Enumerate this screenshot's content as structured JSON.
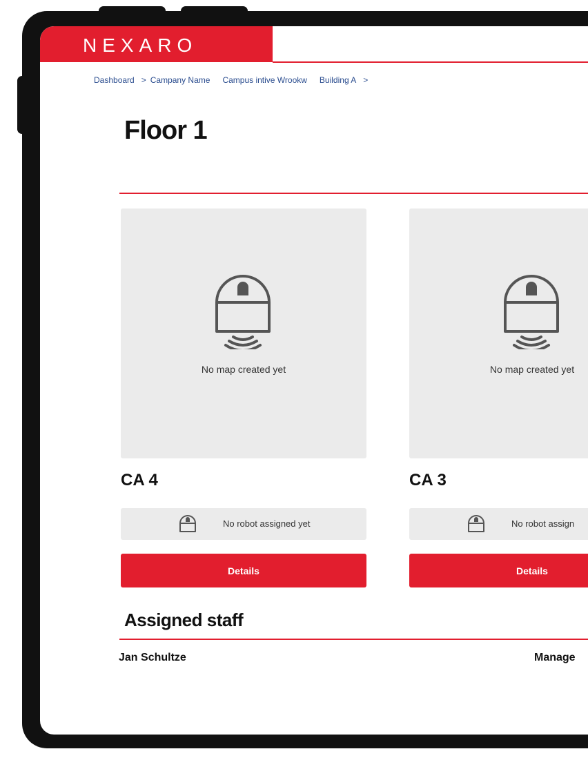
{
  "header": {
    "brand": "NEXARO"
  },
  "breadcrumb": [
    {
      "label": "Dashboard"
    },
    {
      "label": "Campany Name"
    },
    {
      "label": "Campus intive Wrookw"
    },
    {
      "label": "Building A"
    }
  ],
  "page": {
    "title": "Floor 1"
  },
  "cards": [
    {
      "name": "CA 4",
      "map_status": "No map created yet",
      "robot_status": "No robot assigned yet",
      "button": "Details"
    },
    {
      "name": "CA 3",
      "map_status": "No map created yet",
      "robot_status": "No robot assign",
      "button": "Details"
    }
  ],
  "staff": {
    "title": "Assigned staff",
    "rows": [
      {
        "name": "Jan Schultze",
        "role": "Manage"
      }
    ]
  },
  "colors": {
    "accent": "#e21e2e",
    "card_bg": "#ebebeb",
    "link": "#2b4d8f"
  },
  "icons": {
    "map_placeholder": "robot-signal-icon",
    "robot": "robot-icon"
  }
}
